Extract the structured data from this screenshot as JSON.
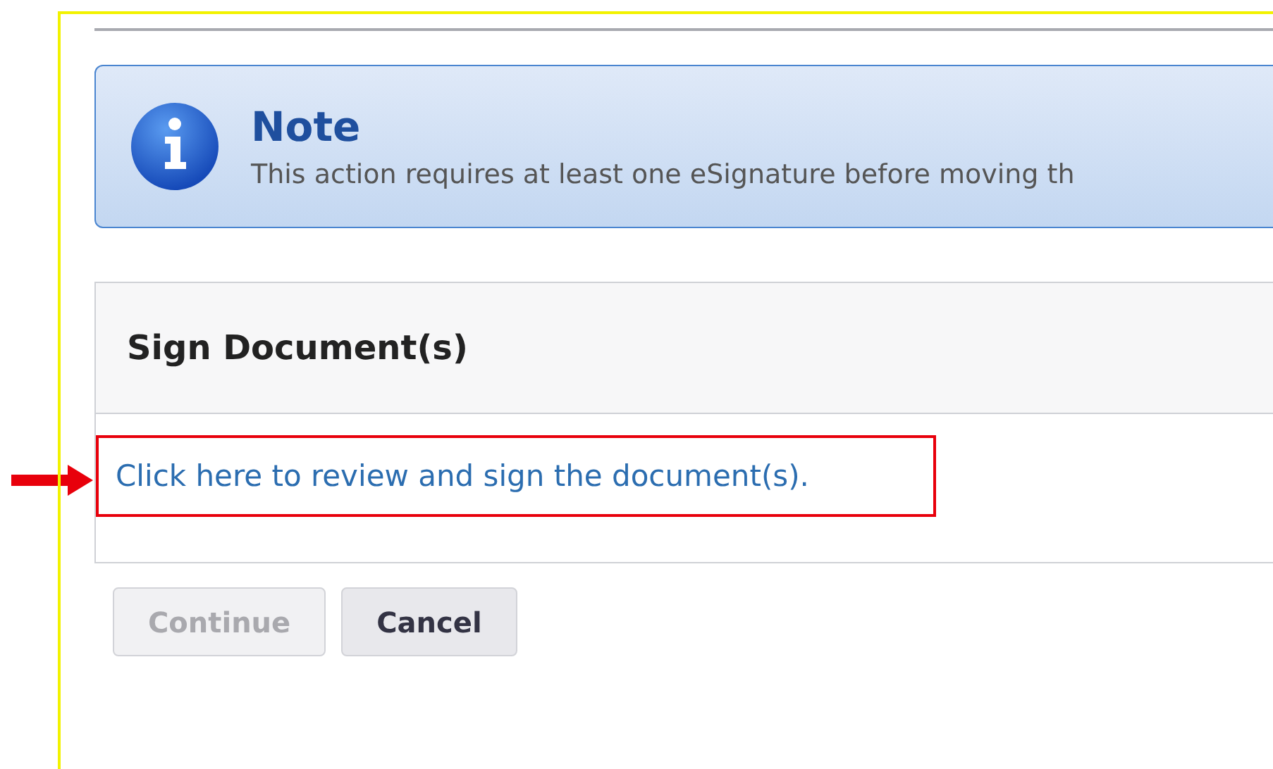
{
  "note": {
    "title": "Note",
    "message": "This action requires at least one eSignature before moving th"
  },
  "panel": {
    "title": "Sign Document(s)",
    "link": "Click here to review and sign the document(s).",
    "highlighted": true
  },
  "buttons": [
    {
      "label": "Continue",
      "disabled": true
    },
    {
      "label": "Cancel",
      "disabled": false
    }
  ]
}
